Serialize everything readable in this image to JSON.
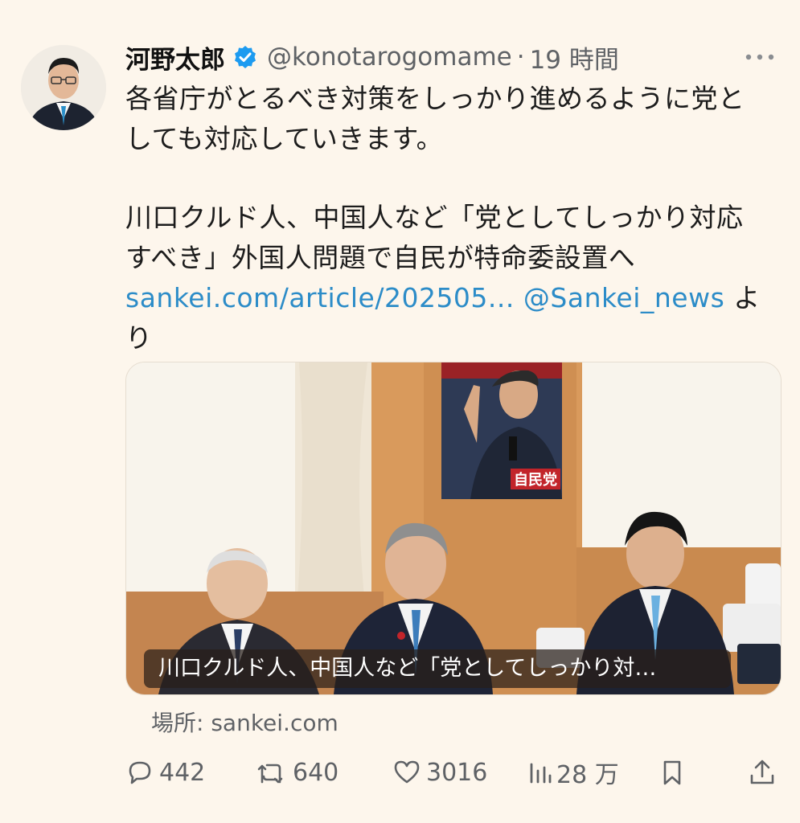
{
  "author": {
    "name": "河野太郎",
    "handle": "@konotarogomame",
    "separator": "·",
    "time": "19 時間",
    "verified_icon": "verified-badge-icon"
  },
  "tweet": {
    "lines": [
      "各省庁がとるべき対策をしっかり進めるように党と",
      "しても対応していきます。"
    ],
    "quote_lines": [
      "川口クルド人、中国人など「党としてしっかり対応",
      "すべき」外国人問題で自民が特命委設置へ"
    ],
    "link_url": "sankei.com/article/202505...",
    "mention": "@Sankei_news",
    "suffix_a": "よ",
    "suffix_b": "り"
  },
  "card": {
    "poster_text": "自民党",
    "caption": "川口クルド人、中国人など「党としてしっかり対…"
  },
  "source": "場所: sankei.com",
  "actions": {
    "replies": "442",
    "reposts": "640",
    "likes": "3016",
    "views": "28 万"
  },
  "colors": {
    "background": "#fdf6ec",
    "link": "#2c8cc8",
    "verified": "#1d9bf0",
    "muted": "#5f6266"
  }
}
